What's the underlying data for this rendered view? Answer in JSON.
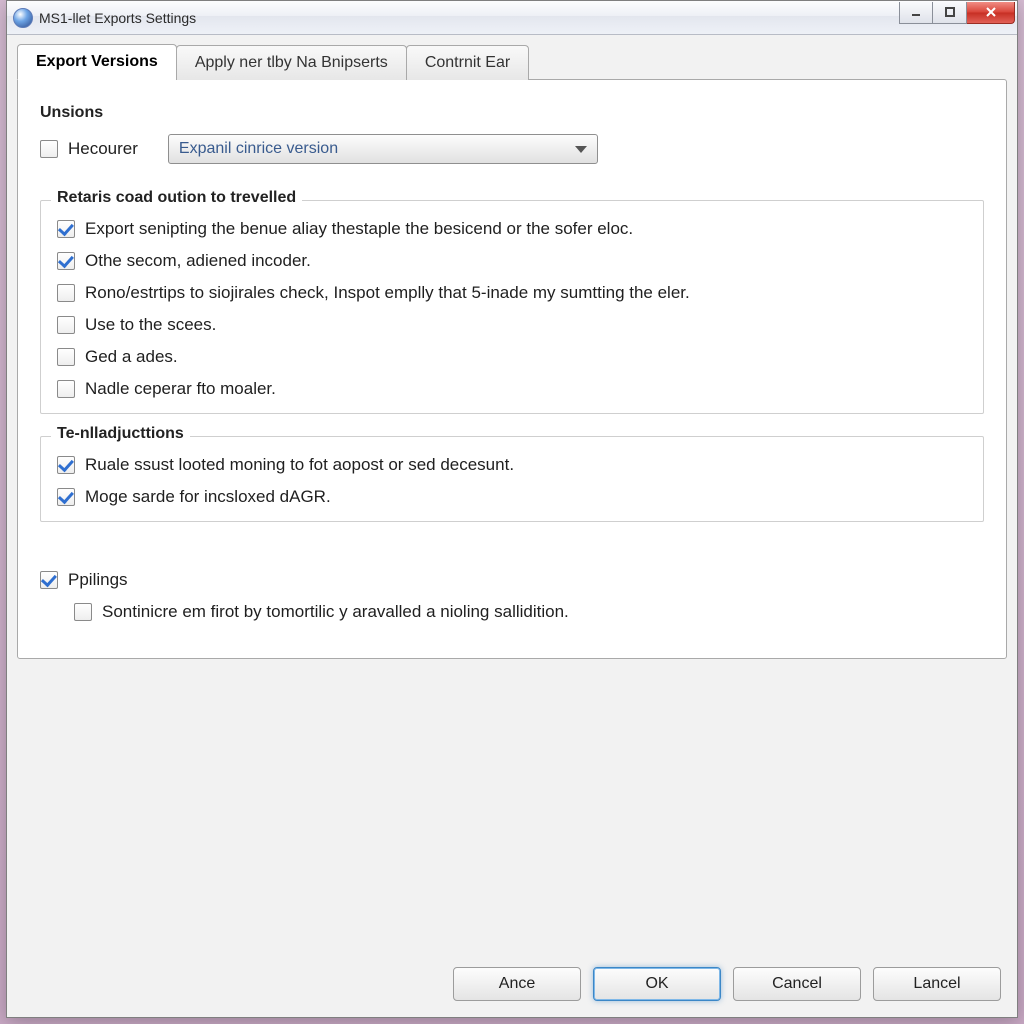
{
  "window": {
    "title": "MS1-llet Exports Settings"
  },
  "tabs": [
    {
      "label": "Export Versions",
      "active": true
    },
    {
      "label": "Apply ner tlby Na Bnipserts",
      "active": false
    },
    {
      "label": "Contrnit Ear",
      "active": false
    }
  ],
  "section_unsions": {
    "legend": "Unsions",
    "hecourer": {
      "label": "Hecourer",
      "checked": false
    },
    "dropdown_value": "Expanil cinrice version"
  },
  "section_retaris": {
    "legend": "Retaris coad oution to trevelled",
    "options": [
      {
        "label": "Export senipting the benue aliay thestaple the besicend or the sofer eloc.",
        "checked": true
      },
      {
        "label": "Othe secom, adiened incoder.",
        "checked": true
      },
      {
        "label": "Rono/estrtips to siojirales check, Inspot emplly that 5-inade my sumtting the eler.",
        "checked": false
      },
      {
        "label": "Use to the scees.",
        "checked": false
      },
      {
        "label": "Ged a ades.",
        "checked": false
      },
      {
        "label": "Nadle ceperar fto moaler.",
        "checked": false
      }
    ]
  },
  "section_tenil": {
    "legend": "Te-nlladjucttions",
    "options": [
      {
        "label": "Ruale ssust looted moning to fot aopost or sed decesunt.",
        "checked": true
      },
      {
        "label": "Moge sarde for incsloxed dAGR.",
        "checked": true
      }
    ]
  },
  "section_polings": {
    "top": {
      "label": "Ppilings",
      "checked": true
    },
    "sub": {
      "label": "Sontinicre em firot by tomortilic y aravalled a nioling sallidition.",
      "checked": false
    }
  },
  "footer": {
    "ance": "Ance",
    "ok": "OK",
    "cancel": "Cancel",
    "lancel": "Lancel"
  }
}
